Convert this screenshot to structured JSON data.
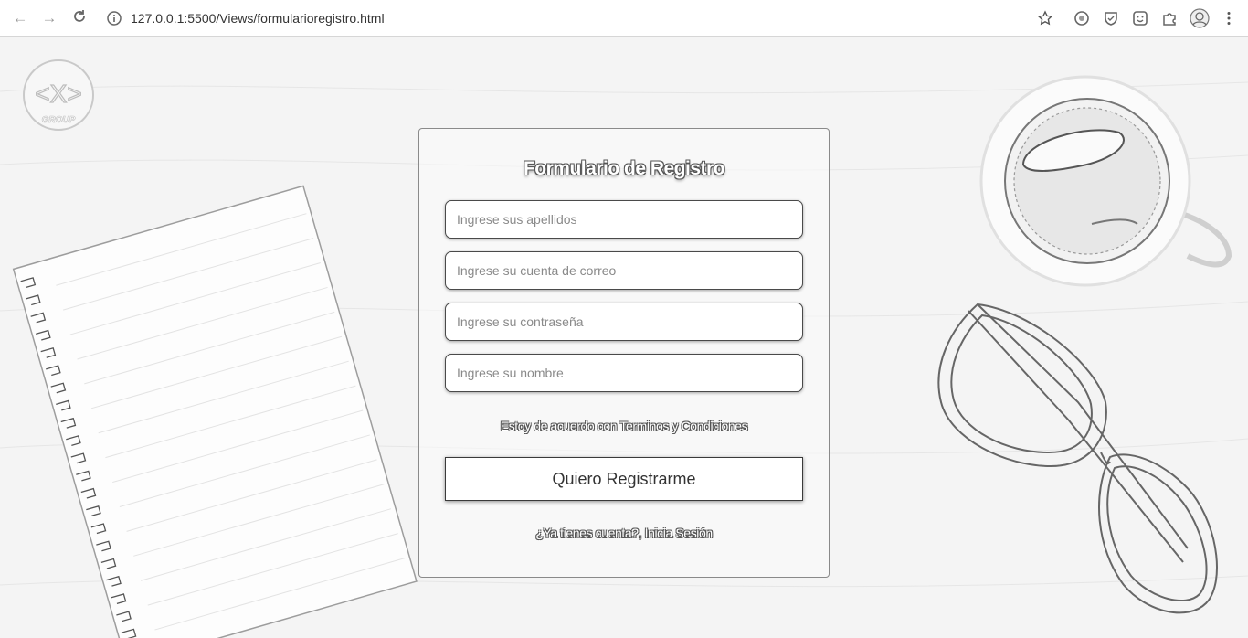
{
  "browser": {
    "url": "127.0.0.1:5500/Views/formularioregistro.html",
    "back_icon": "arrow-left-icon",
    "forward_icon": "arrow-right-icon",
    "reload_icon": "reload-icon",
    "star_icon": "star-icon"
  },
  "logo": {
    "text": "GROUP"
  },
  "form": {
    "title": "Formulario de Registro",
    "fields": [
      {
        "placeholder": "Ingrese sus apellidos",
        "value": ""
      },
      {
        "placeholder": "Ingrese su cuenta de correo",
        "value": ""
      },
      {
        "placeholder": "Ingrese su contraseña",
        "value": ""
      },
      {
        "placeholder": "Ingrese su nombre",
        "value": ""
      }
    ],
    "terms_text": "Estoy de acuerdo con Terminos y Condiciones",
    "submit_label": "Quiero Registrarme",
    "login_text": "¿Ya tienes cuenta?, Inicia Sesión"
  },
  "colors": {
    "outline": "#4a4a4a",
    "background": "#f4f4f4"
  }
}
